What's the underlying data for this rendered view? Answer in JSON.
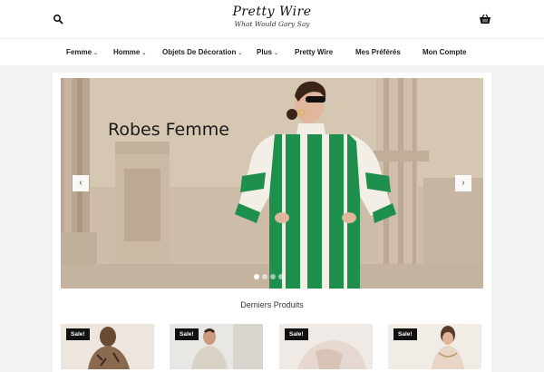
{
  "header": {
    "logo_name": "Pretty Wire",
    "logo_tagline": "What Would Gary Say",
    "search_icon": "search-icon",
    "cart_icon": "shopping-basket-icon"
  },
  "nav": {
    "items": [
      {
        "label": "Femme",
        "has_dropdown": true
      },
      {
        "label": "Homme",
        "has_dropdown": true
      },
      {
        "label": "Objets De Décoration",
        "has_dropdown": true
      },
      {
        "label": "Plus",
        "has_dropdown": true
      },
      {
        "label": "Pretty Wire",
        "has_dropdown": false
      },
      {
        "label": "Mes Préférés",
        "has_dropdown": false
      },
      {
        "label": "Mon Compte",
        "has_dropdown": false
      }
    ],
    "dropdown_glyph": "⌄"
  },
  "slider": {
    "title": "Robes Femme",
    "prev_glyph": "‹",
    "next_glyph": "›",
    "slide_count": 4,
    "active_slide": 1
  },
  "products": {
    "heading": "Derniers Produits",
    "items": [
      {
        "badge": "Sale!"
      },
      {
        "badge": "Sale!"
      },
      {
        "badge": "Sale!"
      },
      {
        "badge": "Sale!"
      }
    ]
  },
  "colors": {
    "accent_green": "#1f8f4e",
    "badge_bg": "#111111",
    "page_bg": "#f2f2f2"
  }
}
